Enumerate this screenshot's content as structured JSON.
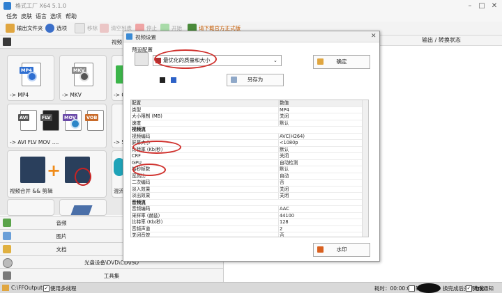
{
  "window": {
    "title": "格式工厂 X64 5.1.0"
  },
  "menu": [
    "任务",
    "皮肤",
    "语言",
    "选项",
    "帮助"
  ],
  "toolbar": {
    "output_folder": "输出文件夹",
    "options": "选项",
    "remove": "移除",
    "clear_list": "清空列表",
    "stop": "停止",
    "start": "开始",
    "download_official": "请下载官方正式版"
  },
  "left": {
    "header": "视频",
    "tiles": [
      {
        "label": "-> MP4",
        "tag": "MP4",
        "color": "#2f6fd1"
      },
      {
        "label": "-> MKV",
        "tag": "MKV",
        "color": "#8a8a8a"
      },
      {
        "label": "-> AVI FLV MOV ....",
        "tags": [
          "AVI",
          "FLV",
          "MOV",
          "VOB"
        ]
      },
      {
        "label": "视频合并 && 剪辑"
      },
      {
        "label": "",
        "partial": "-> G"
      },
      {
        "label": "",
        "partial": "-> 5"
      },
      {
        "label": "",
        "partial": "混流"
      }
    ],
    "categories": [
      "音频",
      "图片",
      "文档"
    ],
    "bottom": [
      "光盘设备\\DVD\\CD\\ISO",
      "工具集"
    ]
  },
  "right": {
    "column_header": "输出 / 转换状态"
  },
  "status": {
    "path": "C:\\FFOutput",
    "multithread_label": "使用多线程",
    "elapsed_label": "耗时：00:00:00",
    "after_convert": "转",
    "shutdown": "换完成后关闭电脑",
    "notify": "完成通知"
  },
  "dialog": {
    "title": "视频设置",
    "preset_label": "预设配置",
    "preset_value": "最优化的质量和大小",
    "ok": "确定",
    "save_as": "另存为",
    "watermark": "水印",
    "grid_header_key": "配置",
    "grid_header_value": "数值",
    "rows": [
      {
        "k": "类型",
        "v": "MP4"
      },
      {
        "k": "大小限制 (MB)",
        "v": "关闭"
      },
      {
        "k": "速度",
        "v": "默认"
      },
      {
        "k": "视频流",
        "v": "",
        "section": true
      },
      {
        "k": "视频编码",
        "v": "AVC(H264)"
      },
      {
        "k": "屏幕大小",
        "v": "<1080p"
      },
      {
        "k": "比特率 (Kb/秒)",
        "v": "默认"
      },
      {
        "k": "CRF",
        "v": "关闭"
      },
      {
        "k": "GPU",
        "v": "自动检测"
      },
      {
        "k": "每秒帧数",
        "v": "默认"
      },
      {
        "k": "宽高比",
        "v": "自动"
      },
      {
        "k": "二次编码",
        "v": "否"
      },
      {
        "k": "淡入效果",
        "v": "关闭"
      },
      {
        "k": "淡出效果",
        "v": "关闭"
      },
      {
        "k": "音频流",
        "v": "",
        "section": true
      },
      {
        "k": "音频编码",
        "v": "AAC"
      },
      {
        "k": "采样率 (赫兹)",
        "v": "44100"
      },
      {
        "k": "比特率 (Kb/秒)",
        "v": "128"
      },
      {
        "k": "音频声道",
        "v": "2"
      },
      {
        "k": "关闭音效",
        "v": "否"
      }
    ]
  }
}
